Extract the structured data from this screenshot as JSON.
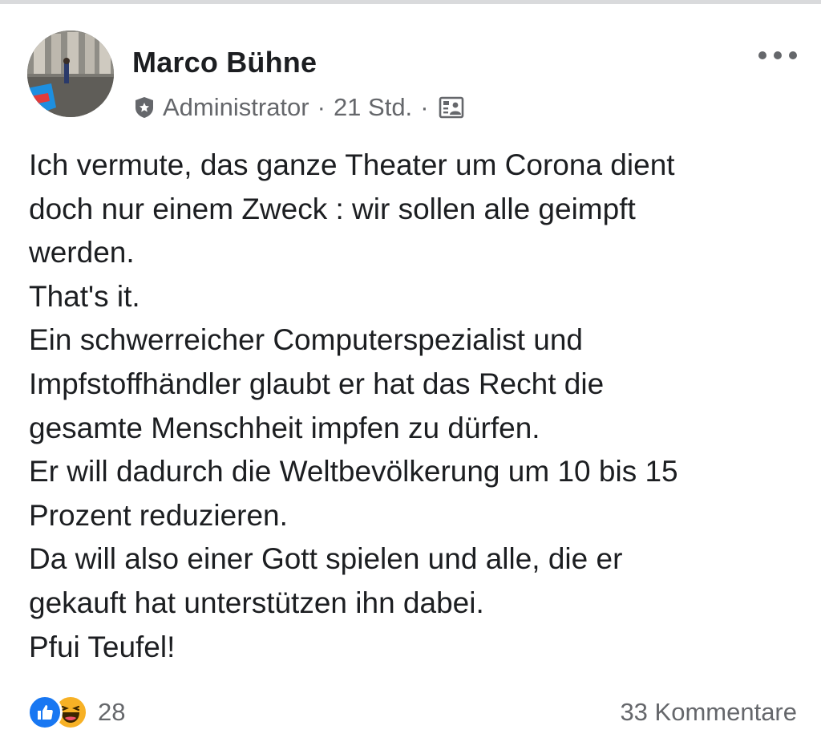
{
  "post": {
    "author": {
      "name": "Marco Bühne"
    },
    "meta": {
      "badge_icon": "admin-shield-icon",
      "role": "Administrator",
      "separator_1": "·",
      "timestamp": "21 Std.",
      "separator_2": "·",
      "audience_icon": "group-members-icon"
    },
    "more_icon": "more-options-icon",
    "text_lines": [
      "Ich vermute, das ganze Theater um Corona dient",
      "doch nur einem Zweck : wir sollen alle geimpft",
      "werden.",
      "That's it.",
      "Ein schwerreicher Computerspezialist und",
      "Impfstoffhändler glaubt er hat das Recht die",
      "gesamte Menschheit impfen zu dürfen.",
      "Er will dadurch die Weltbevölkerung um 10 bis 15",
      "Prozent reduzieren.",
      "Da will also einer Gott spielen und alle, die er",
      "gekauft hat unterstützen ihn dabei.",
      "Pfui Teufel!"
    ],
    "reactions": {
      "icons": [
        "like-reaction-icon",
        "haha-reaction-icon"
      ],
      "count": "28"
    },
    "comments": {
      "label": "33 Kommentare"
    }
  },
  "colors": {
    "text_primary": "#1c1e21",
    "text_secondary": "#65676b",
    "like_blue": "#1877f2",
    "haha_yellow": "#f7b125",
    "top_rule": "#d9dadc"
  }
}
